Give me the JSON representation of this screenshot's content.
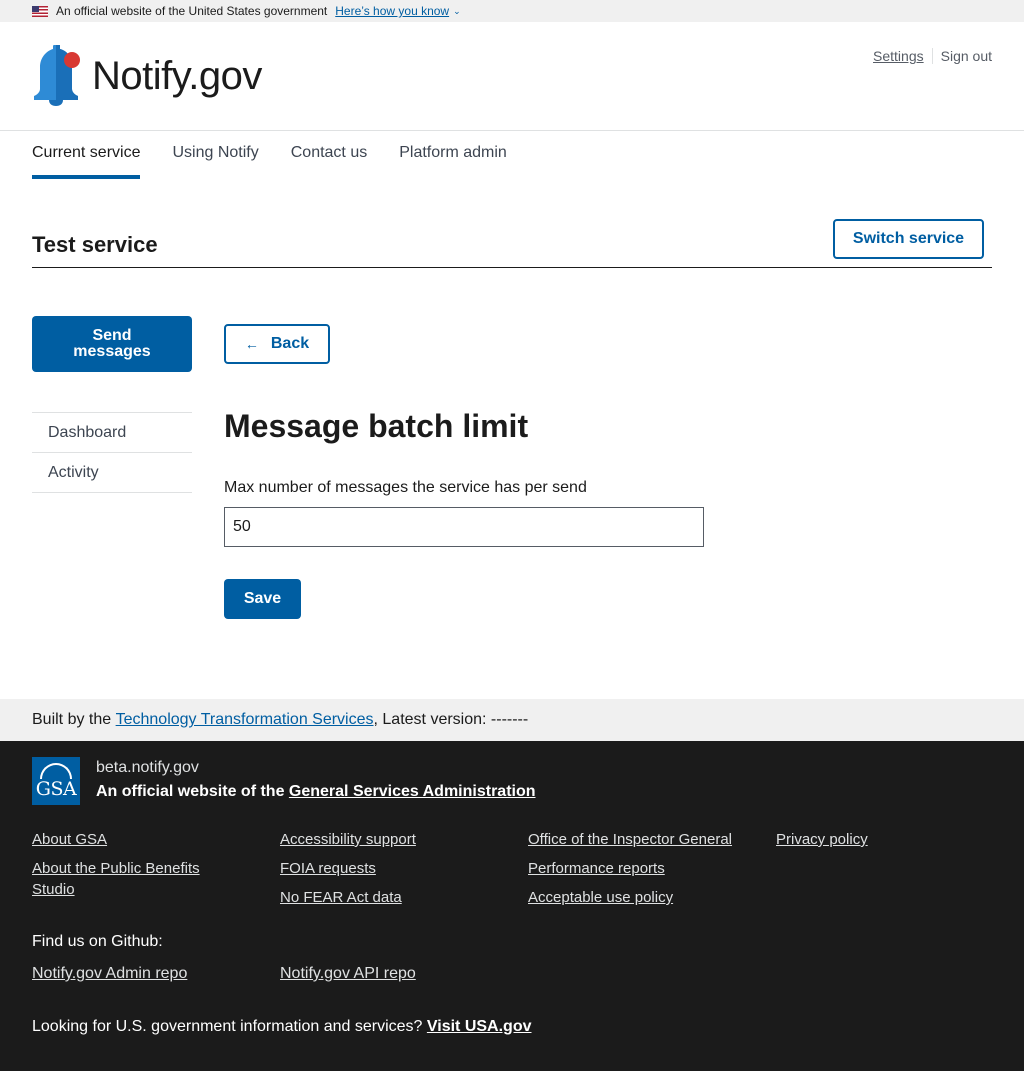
{
  "gov_banner": {
    "text": "An official website of the United States government",
    "link": "Here’s how you know"
  },
  "header": {
    "logo_text": "Notify.gov",
    "settings": "Settings",
    "sign_out": "Sign out"
  },
  "nav": {
    "items": [
      {
        "label": "Current service"
      },
      {
        "label": "Using Notify"
      },
      {
        "label": "Contact us"
      },
      {
        "label": "Platform admin"
      }
    ]
  },
  "service": {
    "title": "Test service",
    "switch_label": "Switch service"
  },
  "sidebar": {
    "send_label": "Send messages",
    "items": [
      {
        "label": "Dashboard"
      },
      {
        "label": "Activity"
      }
    ]
  },
  "main": {
    "back_label": "Back",
    "title": "Message batch limit",
    "field_label": "Max number of messages the service has per send",
    "field_value": "50",
    "save_label": "Save"
  },
  "build_bar": {
    "prefix": "Built by the ",
    "link": "Technology Transformation Services",
    "suffix": ", Latest version: -------"
  },
  "footer": {
    "domain": "beta.notify.gov",
    "official_prefix": "An official website of the ",
    "official_link": "General Services Administration",
    "gsa_logo": "GSA",
    "links": [
      {
        "label": "About GSA"
      },
      {
        "label": "About the Public Benefits Studio"
      },
      {
        "label": "Accessibility support"
      },
      {
        "label": "FOIA requests"
      },
      {
        "label": "No FEAR Act data"
      },
      {
        "label": "Office of the Inspector General"
      },
      {
        "label": "Performance reports"
      },
      {
        "label": "Acceptable use policy"
      },
      {
        "label": "Privacy policy"
      }
    ],
    "github_title": "Find us on Github:",
    "github_links": [
      {
        "label": "Notify.gov Admin repo"
      },
      {
        "label": "Notify.gov API repo"
      }
    ],
    "usa_prefix": "Looking for U.S. government information and services? ",
    "usa_link": "Visit USA.gov"
  },
  "colors": {
    "primary": "#005ea2",
    "bell_accent": "#d83933",
    "footer_bg": "#1b1b1b"
  }
}
